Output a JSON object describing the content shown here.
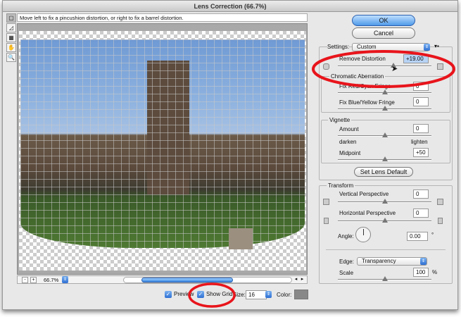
{
  "window": {
    "title": "Lens Correction (66.7%)"
  },
  "hint": "Move left to fix a pincushion distortion, or right to fix a barrel distortion.",
  "tools": [
    "remove-distortion-tool",
    "straighten-tool",
    "move-grid-tool",
    "hand-tool",
    "zoom-tool"
  ],
  "bottom": {
    "zoom_out": "-",
    "zoom_in": "+",
    "zoom_value": "66.7%",
    "scroll_left": "◂",
    "scroll_right": "▸"
  },
  "options": {
    "preview": "Preview",
    "show_grid": "Show Grid",
    "size_label": "Size:",
    "size_value": "16",
    "color_label": "Color:",
    "grid_color": "#888888"
  },
  "buttons": {
    "ok": "OK",
    "cancel": "Cancel",
    "set_lens_default": "Set Lens Default"
  },
  "settings": {
    "label": "Settings:",
    "value": "Custom",
    "remove_distortion": {
      "label": "Remove Distortion",
      "value": "+19.00",
      "slider": 0.595
    },
    "chromatic": {
      "label": "Chromatic Aberration",
      "red_cyan": {
        "label": "Fix Red/Cyan Fringe",
        "value": "0",
        "slider": 0.5
      },
      "blue_yellow": {
        "label": "Fix Blue/Yellow Fringe",
        "value": "0",
        "slider": 0.5
      }
    },
    "vignette": {
      "label": "Vignette",
      "amount": {
        "label": "Amount",
        "value": "0",
        "slider": 0.5
      },
      "darken": "darken",
      "lighten": "lighten",
      "midpoint": {
        "label": "Midpoint",
        "value": "+50",
        "slider": 0.5
      }
    }
  },
  "transform": {
    "label": "Transform",
    "vertical": {
      "label": "Vertical Perspective",
      "value": "0",
      "slider": 0.5
    },
    "horizontal": {
      "label": "Horizontal Perspective",
      "value": "0",
      "slider": 0.5
    },
    "angle": {
      "label": "Angle:",
      "value": "0.00",
      "unit": "°"
    },
    "edge": {
      "label": "Edge:",
      "value": "Transparency"
    },
    "scale": {
      "label": "Scale",
      "value": "100",
      "unit": "%",
      "slider": 0.5
    }
  },
  "annotation_color": "#e8141b"
}
